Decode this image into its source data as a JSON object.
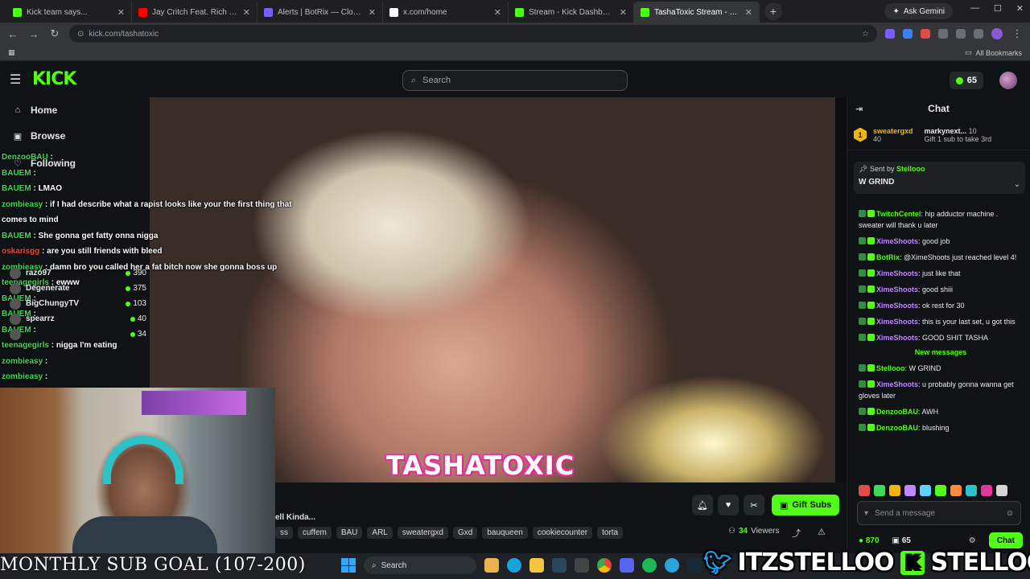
{
  "browser": {
    "tabs": [
      {
        "title": "Kick team says...",
        "color": "#53fc18"
      },
      {
        "title": "Jay Critch Feat. Rich The Kid",
        "color": "#ff0000"
      },
      {
        "title": "Alerts | BotRix — Cloud Stream",
        "color": "#7b5cff"
      },
      {
        "title": "x.com/home",
        "color": "#ffffff"
      },
      {
        "title": "Stream - Kick Dashboard",
        "color": "#53fc18"
      },
      {
        "title": "TashaToxic Stream - Watch",
        "color": "#53fc18"
      }
    ],
    "new_tab": "+",
    "ask_gemini": "Ask Gemini",
    "url": "kick.com/tashatoxic",
    "all_bookmarks": "All Bookmarks"
  },
  "header": {
    "logo": "KICK",
    "search_placeholder": "Search",
    "points": "65"
  },
  "leftnav": {
    "home": "Home",
    "browse": "Browse",
    "following": "Following"
  },
  "overlay_chat": [
    {
      "user": "DenzooBAU",
      "text": ""
    },
    {
      "user": "BAUEM",
      "text": ""
    },
    {
      "user": "BAUEM",
      "text": "LMAO"
    },
    {
      "user": "zombieasy",
      "text": "if I had describe what a rapist looks like your the first thing that"
    },
    {
      "user": "",
      "text": "comes to mind"
    },
    {
      "user": "BAUEM",
      "text": "She gonna get fatty onna nigga"
    },
    {
      "user": "oskarisgg",
      "text": "are you still friends with bleed"
    },
    {
      "user": "zombieasy",
      "text": "damn bro you called her a fat bitch now she gonna boss up"
    },
    {
      "user": "teenagegirls",
      "text": "ewww"
    },
    {
      "user": "BAUEM",
      "text": ""
    },
    {
      "user": "BAUEM",
      "text": ""
    },
    {
      "user": "BAUEM",
      "text": ""
    },
    {
      "user": "teenagegirls",
      "text": "nigga I'm eating"
    },
    {
      "user": "zombieasy",
      "text": ""
    },
    {
      "user": "zombieasy",
      "text": ""
    },
    {
      "user": "zombieasy",
      "text": ""
    }
  ],
  "following_list": [
    {
      "name": "razo97",
      "count": "390"
    },
    {
      "name": "Degenerate",
      "count": "375"
    },
    {
      "name": "BigChungyTV",
      "count": "103"
    },
    {
      "name": "spearrz",
      "count": "40"
    },
    {
      "name": "",
      "count": "34"
    }
  ],
  "stream": {
    "brand_text": "TASHATOXIC",
    "partial_title": "ell Kinda...",
    "tags": [
      "ss",
      "cuffem",
      "BAU",
      "ARL",
      "sweatergxd",
      "Gxd",
      "bauqueen",
      "cookiecounter",
      "torta"
    ],
    "gift_subs": "Gift Subs",
    "viewers_count": "34",
    "viewers_label": "Viewers"
  },
  "chat": {
    "title": "Chat",
    "leaderboard": {
      "rank": "1",
      "first_user": "sweatergxd",
      "first_amount": "40",
      "second_user": "markynext...",
      "second_amount": "10",
      "gift_hint": "Gift 1 sub to take 3rd"
    },
    "pinned": {
      "sent_by_label": "Sent by",
      "sent_by_user": "Stellooo",
      "message": "W GRIND"
    },
    "messages": [
      {
        "user": "TwitchCentel",
        "color": "u",
        "text": "hip adductor machine . sweater will thank u later"
      },
      {
        "user": "XimeShoots",
        "color": "u purple",
        "text": "good job"
      },
      {
        "user": "BotRix",
        "color": "u",
        "text": "@XimeShoots just reached level 4!"
      },
      {
        "user": "XimeShoots",
        "color": "u purple",
        "text": "just like that"
      },
      {
        "user": "XimeShoots",
        "color": "u purple",
        "text": "good shiii"
      },
      {
        "user": "XimeShoots",
        "color": "u purple",
        "text": "ok rest for 30"
      },
      {
        "user": "XimeShoots",
        "color": "u purple",
        "text": "this is your last set, u got this"
      },
      {
        "user": "XimeShoots",
        "color": "u purple",
        "text": "GOOD SHIT TASHA"
      }
    ],
    "new_messages": "New messages",
    "new_messages_list": [
      {
        "user": "Stellooo",
        "color": "u",
        "text": "W GRIND"
      },
      {
        "user": "XimeShoots",
        "color": "u purple",
        "text": "u probably gonna wanna get gloves later"
      },
      {
        "user": "DenzooBAU",
        "color": "u",
        "text": "AWH"
      },
      {
        "user": "DenzooBAU",
        "color": "u",
        "text": "blushing"
      }
    ],
    "input_placeholder": "Send a message",
    "footer_points": "870",
    "footer_subs": "65",
    "send": "Chat"
  },
  "overlay_bottom": {
    "sub_goal": "MONTHLY SUB GOAL (107-200)",
    "twitter_handle": "ITZSTELLOO",
    "kick_handle": "STELLOOO"
  },
  "taskbar": {
    "search": "Search"
  },
  "colors": {
    "kick_green": "#53fc18",
    "background": "#0b0e0f",
    "panel": "#101315"
  }
}
